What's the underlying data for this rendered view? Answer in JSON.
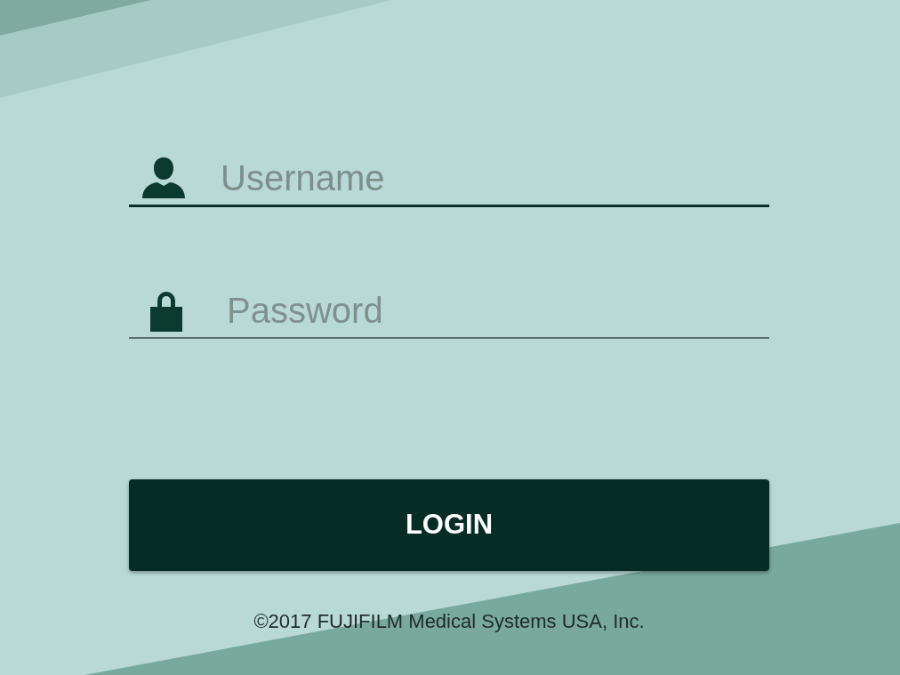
{
  "username": {
    "placeholder": "Username",
    "focused": true
  },
  "password": {
    "placeholder": "Password",
    "focused": false
  },
  "login_button": {
    "label": "LOGIN"
  },
  "footer": {
    "text": "©2017 FUJIFILM Medical Systems USA, Inc."
  }
}
